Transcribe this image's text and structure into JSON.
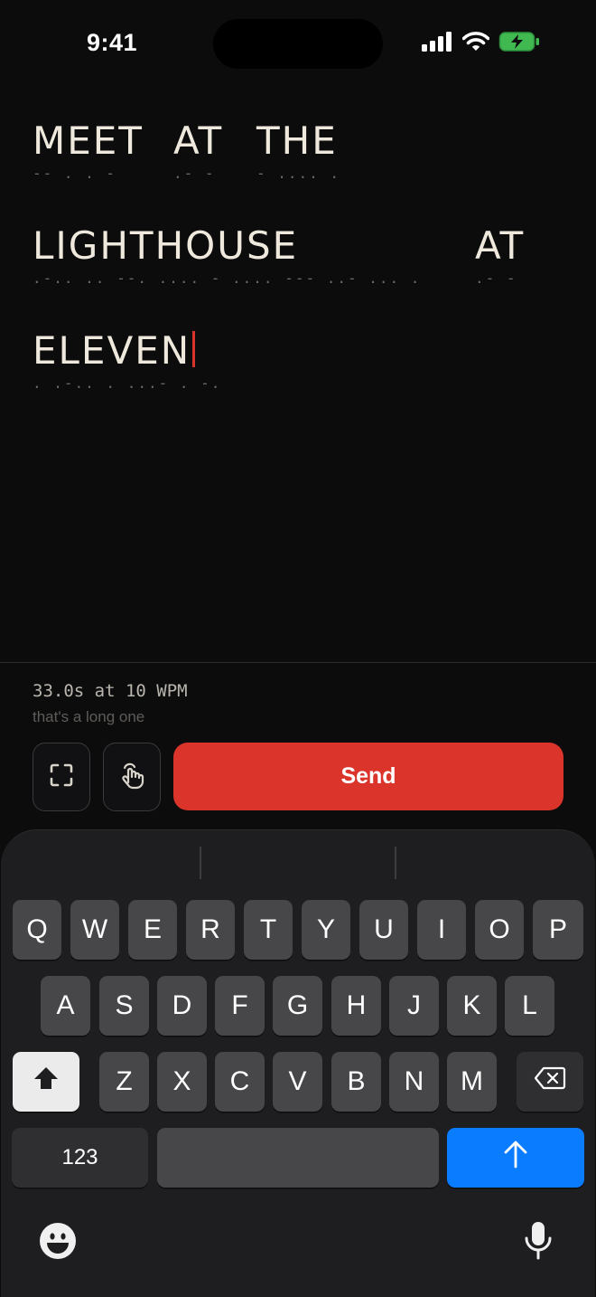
{
  "status_bar": {
    "time": "9:41",
    "icons": [
      "signal-icon",
      "wifi-icon",
      "battery-charging-icon"
    ]
  },
  "message": {
    "lines": [
      {
        "words": [
          {
            "text": "MEET",
            "morse": "-- . . -"
          },
          {
            "text": "AT",
            "morse": ".- -"
          },
          {
            "text": "THE",
            "morse": "- .... ."
          }
        ]
      },
      {
        "words": [
          {
            "text": "LIGHTHOUSE",
            "morse": ".-.. .. --. .... - .... --- ..- ... ."
          },
          {
            "text": "AT",
            "morse": ".- -"
          }
        ]
      },
      {
        "words": [
          {
            "text": "ELEVEN",
            "morse": ". .-.. . ...- . -."
          }
        ]
      }
    ]
  },
  "transmission": {
    "duration": "33.0s at 10 WPM",
    "hint": "that's a long one"
  },
  "controls": {
    "icons": [
      "fullscreen-icon",
      "tap-icon"
    ],
    "send_label": "Send"
  },
  "keyboard": {
    "row1": [
      "Q",
      "W",
      "E",
      "R",
      "T",
      "Y",
      "U",
      "I",
      "O",
      "P"
    ],
    "row2": [
      "A",
      "S",
      "D",
      "F",
      "G",
      "H",
      "J",
      "K",
      "L"
    ],
    "row3": [
      "Z",
      "X",
      "C",
      "V",
      "B",
      "N",
      "M"
    ],
    "numbers_label": "123",
    "icons": [
      "shift-icon",
      "delete-icon",
      "return-arrow-icon",
      "emoji-icon",
      "microphone-icon"
    ]
  },
  "colors": {
    "accent": "#da342b",
    "keyboard_return": "#0a7cff",
    "background": "#0c0c0d"
  }
}
